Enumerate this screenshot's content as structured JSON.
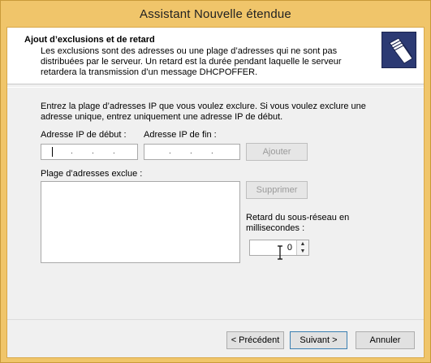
{
  "window": {
    "title": "Assistant Nouvelle étendue"
  },
  "header": {
    "title": "Ajout d’exclusions et de retard",
    "description": "Les exclusions sont des adresses ou une plage d’adresses qui ne sont pas distribuées par le serveur. Un retard est la durée pendant laquelle le serveur retardera la transmission d’un message DHCPOFFER.",
    "icon": "folders-icon"
  },
  "body": {
    "intro": "Entrez la plage d’adresses IP que vous voulez exclure. Si vous voulez exclure une adresse unique, entrez uniquement une adresse IP de début.",
    "start_ip_label": "Adresse IP de début :",
    "start_ip_value": "",
    "end_ip_label": "Adresse IP de fin :",
    "end_ip_value": "",
    "add_button": "Ajouter",
    "excluded_label": "Plage d’adresses exclue :",
    "excluded_items": [],
    "remove_button": "Supprimer",
    "delay_label": "Retard du sous-réseau en millisecondes :",
    "delay_value": "0"
  },
  "footer": {
    "back_button": "< Précédent",
    "next_button": "Suivant >",
    "cancel_button": "Annuler"
  },
  "colors": {
    "frame": "#f0c56a",
    "icon_bg": "#2c3a73",
    "dialog_bg": "#f0f0f0"
  }
}
